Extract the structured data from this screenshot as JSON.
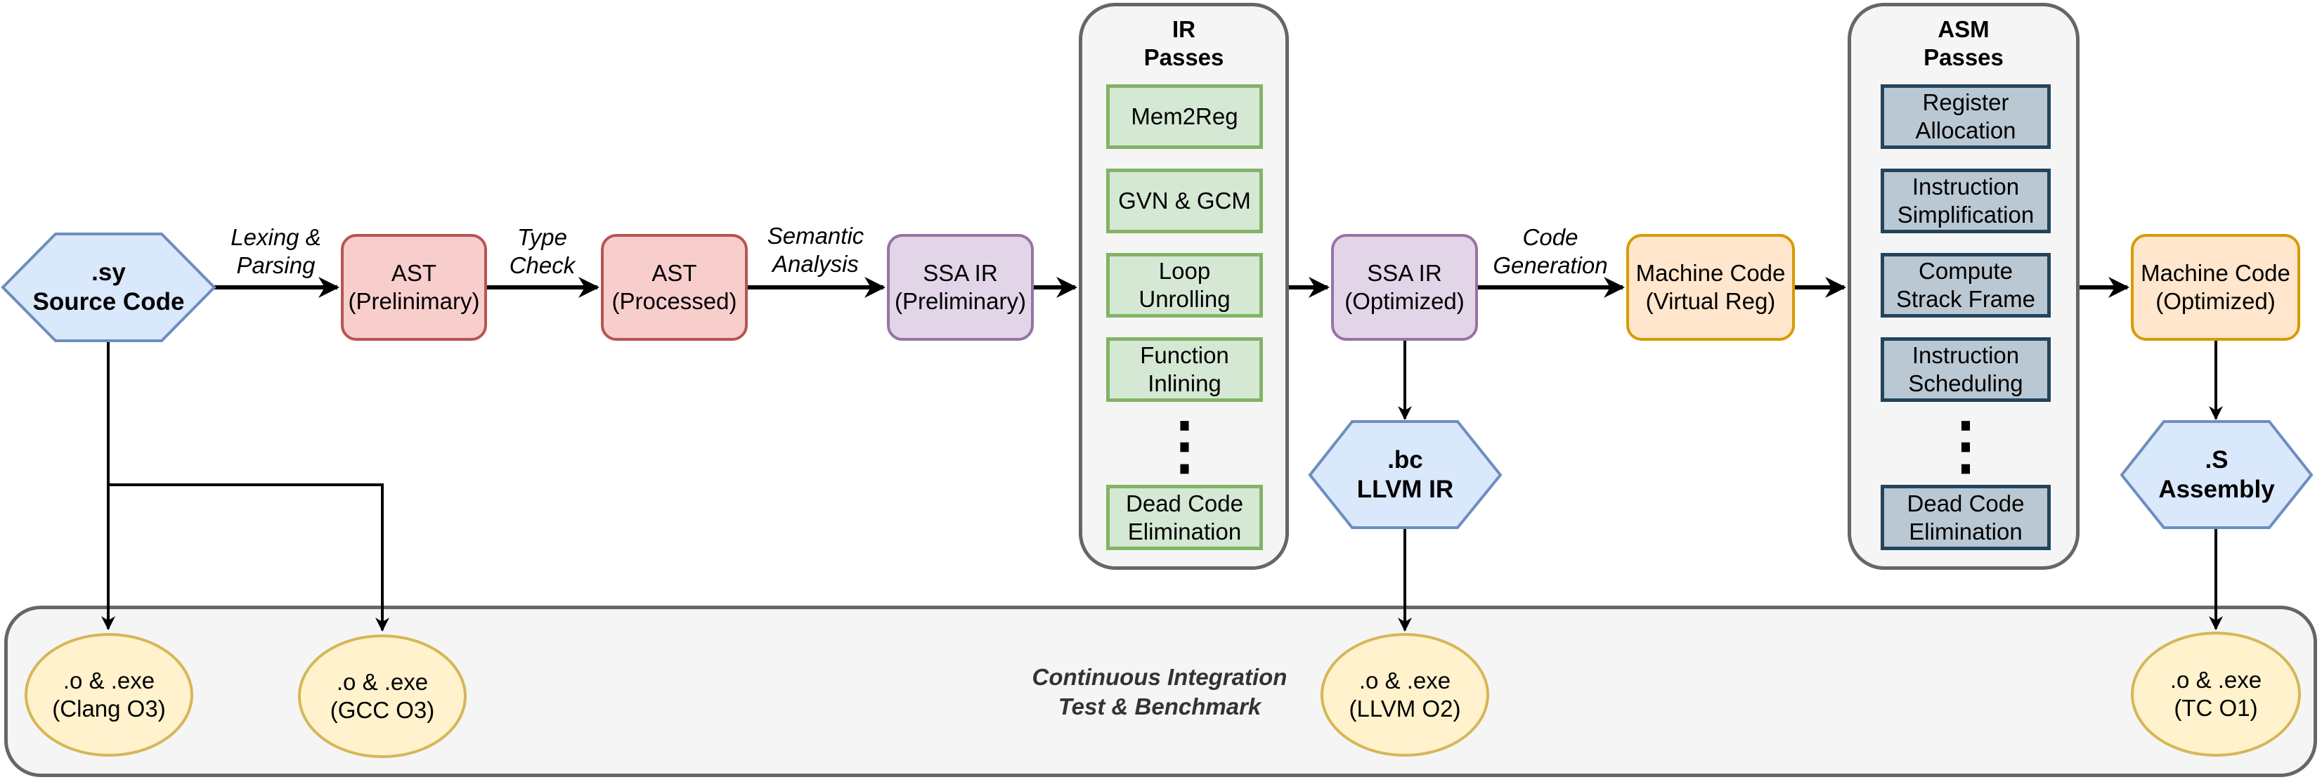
{
  "diagram": {
    "source": {
      "ext": ".sy",
      "label": "Source Code"
    },
    "edge_labels": {
      "lexing": [
        "Lexing &",
        "Parsing"
      ],
      "type_check": [
        "Type",
        "Check"
      ],
      "semantic": [
        "Semantic",
        "Analysis"
      ],
      "codegen": [
        "Code",
        "Generation"
      ]
    },
    "nodes": {
      "ast_prelim": [
        "AST",
        "(Prelinimary)"
      ],
      "ast_processed": [
        "AST",
        "(Processed)"
      ],
      "ssa_prelim": [
        "SSA IR",
        "(Preliminary)"
      ],
      "ssa_opt": [
        "SSA IR",
        "(Optimized)"
      ],
      "mc_virtual": [
        "Machine Code",
        "(Virtual Reg)"
      ],
      "mc_opt": [
        "Machine Code",
        "(Optimized)"
      ]
    },
    "ir_passes": {
      "title": [
        "IR",
        "Passes"
      ],
      "items": [
        [
          "Mem2Reg"
        ],
        [
          "GVN & GCM"
        ],
        [
          "Loop",
          "Unrolling"
        ],
        [
          "Function",
          "Inlining"
        ]
      ],
      "ellipsis": "⋮",
      "last": [
        "Dead Code",
        "Elimination"
      ]
    },
    "asm_passes": {
      "title": [
        "ASM",
        "Passes"
      ],
      "items": [
        [
          "Register",
          "Allocation"
        ],
        [
          "Instruction",
          "Simplification"
        ],
        [
          "Compute",
          "Strack Frame"
        ],
        [
          "Instruction",
          "Scheduling"
        ]
      ],
      "ellipsis": "⋮",
      "last": [
        "Dead Code",
        "Elimination"
      ]
    },
    "bc": {
      "ext": ".bc",
      "label": "LLVM IR"
    },
    "asm": {
      "ext": ".S",
      "label": "Assembly"
    },
    "ci": {
      "title": [
        "Continuous Integration",
        "Test & Benchmark"
      ],
      "outputs": [
        {
          "line1": ".o & .exe",
          "line2": "(Clang O3)"
        },
        {
          "line1": ".o & .exe",
          "line2": "(GCC O3)"
        },
        {
          "line1": ".o & .exe",
          "line2": "(LLVM O2)"
        },
        {
          "line1": ".o & .exe",
          "line2": "(TC O1)"
        }
      ]
    },
    "colors": {
      "ast": "#f8cecc",
      "ssa": "#e1d5e7",
      "machine_code": "#ffe6cc",
      "ir_pass": "#d5e8d4",
      "asm_pass": "#bac8d3",
      "file": "#dae8fc",
      "output": "#fff2cc",
      "container": "#f5f5f5"
    }
  }
}
